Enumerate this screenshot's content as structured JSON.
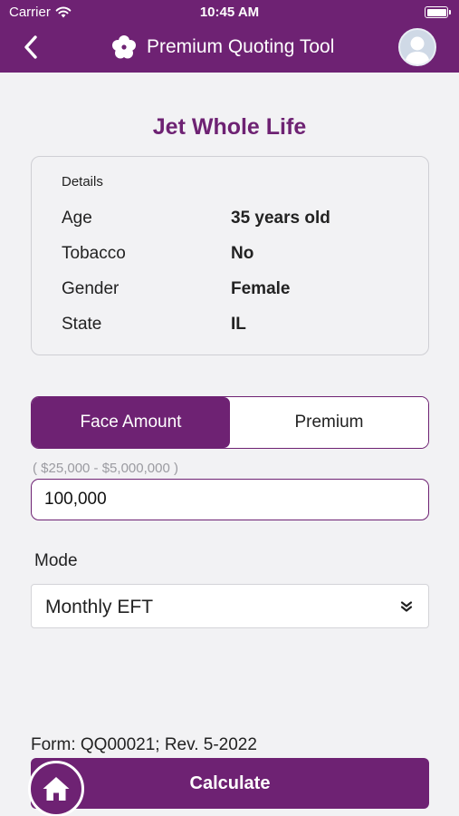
{
  "status_bar": {
    "carrier": "Carrier",
    "time": "10:45 AM"
  },
  "nav": {
    "title": "Premium Quoting Tool"
  },
  "product": {
    "title": "Jet Whole Life"
  },
  "details": {
    "heading": "Details",
    "rows": [
      {
        "label": "Age",
        "value": "35 years old"
      },
      {
        "label": "Tobacco",
        "value": "No"
      },
      {
        "label": "Gender",
        "value": "Female"
      },
      {
        "label": "State",
        "value": "IL"
      }
    ]
  },
  "segments": {
    "options": [
      "Face Amount",
      "Premium"
    ],
    "selected": "Face Amount"
  },
  "amount": {
    "range_hint": "( $25,000 - $5,000,000 )",
    "value": "100,000"
  },
  "mode": {
    "label": "Mode",
    "value": "Monthly EFT"
  },
  "form_id": "Form: QQ00021; Rev. 5-2022",
  "actions": {
    "calculate_label": "Calculate"
  },
  "colors": {
    "brand_purple": "#6e2273",
    "background": "#f2f2f4",
    "hint_gray": "#9b9ba1"
  },
  "icons": [
    "wifi-icon",
    "battery-icon",
    "back-chevron-icon",
    "flower-logo-icon",
    "user-avatar-icon",
    "chevron-down-double-icon",
    "home-icon"
  ]
}
